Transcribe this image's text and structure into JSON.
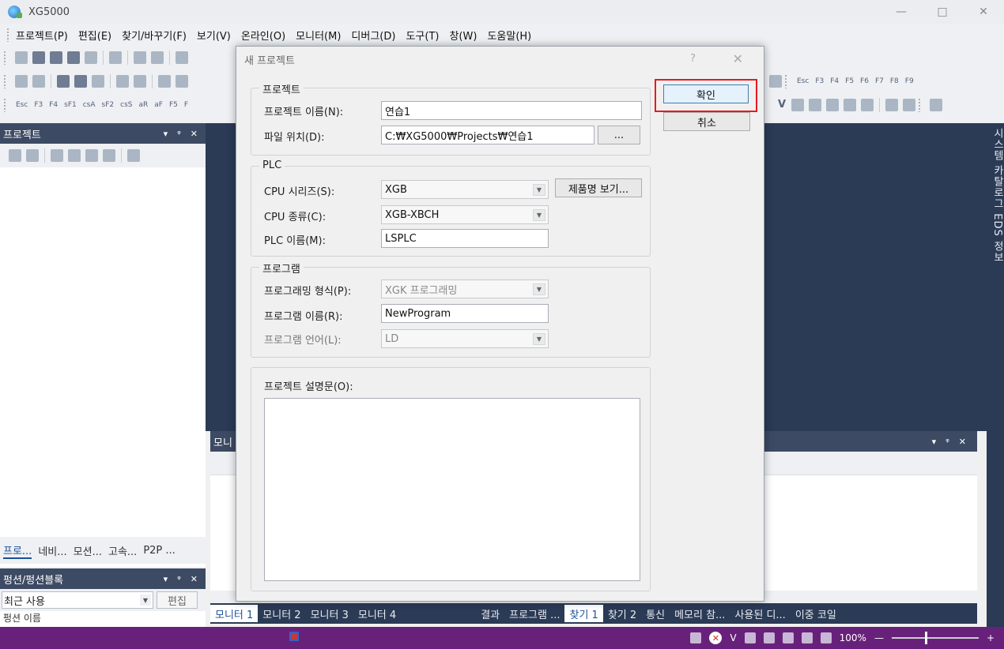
{
  "window": {
    "title": "XG5000",
    "minimize": "—",
    "maximize": "□",
    "close": "✕"
  },
  "menu": [
    "프로젝트(P)",
    "편집(E)",
    "찾기/바꾸기(F)",
    "보기(V)",
    "온라인(O)",
    "모니터(M)",
    "디버그(D)",
    "도구(T)",
    "창(W)",
    "도움말(H)"
  ],
  "toolbar": {
    "fkeys_left": [
      "Esc",
      "F3",
      "F4",
      "sF1",
      "csA",
      "sF2",
      "csS",
      "aR",
      "aF",
      "F5",
      "F"
    ],
    "fkeys_right": [
      "Esc",
      "F3",
      "F4",
      "F5",
      "F6",
      "F7",
      "F8",
      "F9"
    ],
    "v_label": "V"
  },
  "project_panel": {
    "title": "프로젝트",
    "pin": "▾",
    "dock": "ᵠ",
    "close": "✕",
    "tabs": [
      "프로...",
      "네비...",
      "모션...",
      "고속...",
      "P2P ..."
    ]
  },
  "function_panel": {
    "title": "펑션/펑션블록",
    "select_value": "최근 사용",
    "edit_button": "편집",
    "sub_text": "펑션 이름"
  },
  "side_rail": {
    "text": "시스템 카탈로그 EDS 정보"
  },
  "monitor_panel": {
    "title": "모니",
    "tabs_left": [
      "모니터 1",
      "모니터 2",
      "모니터 3",
      "모니터 4"
    ],
    "tabs_right": [
      "결과",
      "프로그램 ...",
      "찾기 1",
      "찾기 2",
      "통신",
      "메모리 참...",
      "사용된 디...",
      "이중 코일"
    ]
  },
  "statusbar": {
    "zoom": "100%",
    "minus": "—",
    "plus": "+"
  },
  "dialog": {
    "title": "새 프로젝트",
    "help": "?",
    "close": "✕",
    "ok_label": "확인",
    "cancel_label": "취소",
    "project_group": {
      "label": "프로젝트",
      "name_label": "프로젝트 이름(N):",
      "name_value": "연습1",
      "path_label": "파일 위치(D):",
      "path_value": "C:₩XG5000₩Projects₩연습1",
      "browse": "..."
    },
    "plc_group": {
      "label": "PLC",
      "cpu_series_label": "CPU 시리즈(S):",
      "cpu_series_value": "XGB",
      "product_button": "제품명 보기...",
      "cpu_type_label": "CPU 종류(C):",
      "cpu_type_value": "XGB-XBCH",
      "plc_name_label": "PLC 이름(M):",
      "plc_name_value": "LSPLC"
    },
    "program_group": {
      "label": "프로그램",
      "format_label": "프로그래밍 형식(P):",
      "format_value": "XGK 프로그래밍",
      "name_label": "프로그램 이름(R):",
      "name_value": "NewProgram",
      "lang_label": "프로그램 언어(L):",
      "lang_value": "LD"
    },
    "description_group": {
      "label": "프로젝트 설명문(O):"
    }
  }
}
